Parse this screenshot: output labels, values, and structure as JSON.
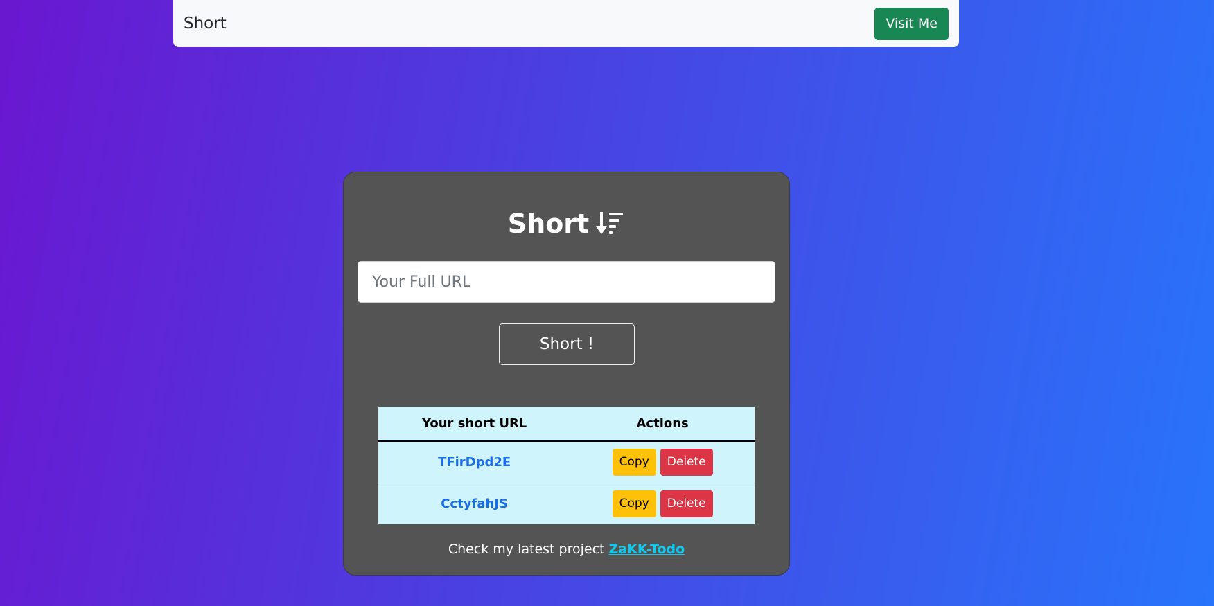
{
  "navbar": {
    "brand": "Short",
    "visit_label": "Visit Me",
    "visit_color": "#198754"
  },
  "card": {
    "title": "Short",
    "title_icon": "sort-down-icon",
    "input_placeholder": "Your Full URL",
    "input_value": "",
    "submit_label": "Short !",
    "table": {
      "headers": [
        "Your short URL",
        "Actions"
      ],
      "rows": [
        {
          "code": "TFirDpd2E",
          "copy_label": "Copy",
          "delete_label": "Delete"
        },
        {
          "code": "CctyfahJS",
          "copy_label": "Copy",
          "delete_label": "Delete"
        }
      ]
    },
    "footer_text": "Check my latest project",
    "footer_link": "ZaKK-Todo"
  },
  "colors": {
    "card_bg": "#545454",
    "table_bg": "#cff4fc",
    "copy": "#ffc107",
    "delete": "#dc3545",
    "link": "#1a6ee8",
    "footer_link": "#0dcaf0"
  }
}
